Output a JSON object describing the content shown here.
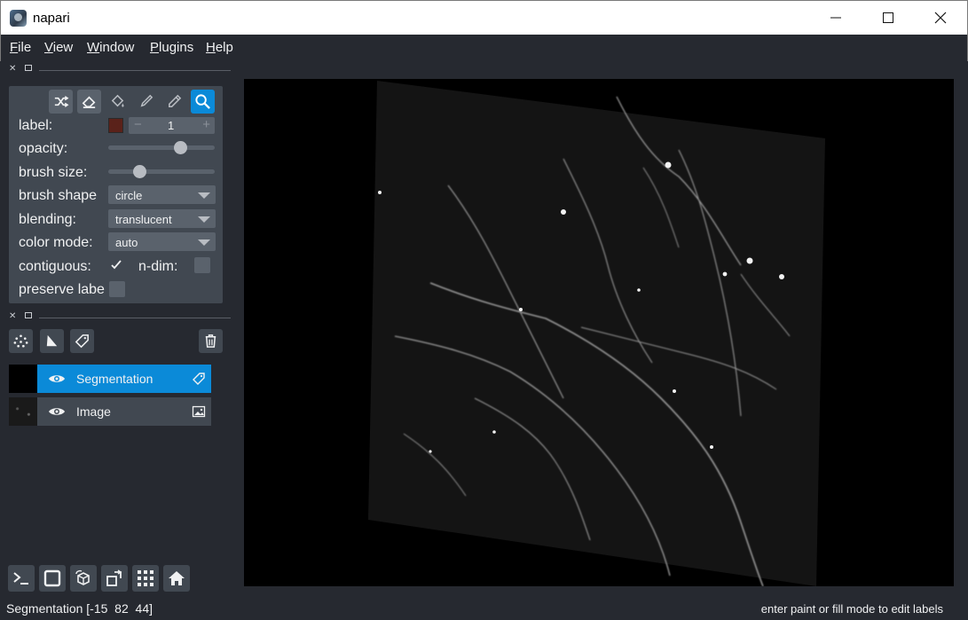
{
  "window": {
    "title": "napari",
    "icon": "napari-logo-icon"
  },
  "menu": [
    {
      "key": "F",
      "rest": "ile"
    },
    {
      "key": "V",
      "rest": "iew"
    },
    {
      "key": "W",
      "rest": "indow"
    },
    {
      "key": "P",
      "rest": "lugins"
    },
    {
      "key": "H",
      "rest": "elp"
    }
  ],
  "layer_controls": {
    "tools": [
      "shuffle-colors-icon",
      "eraser-icon",
      "fill-bucket-icon",
      "paintbrush-icon",
      "color-picker-icon",
      "pan-zoom-icon"
    ],
    "active_tool": "pan-zoom-icon",
    "label_caption": "label:",
    "label_value": "1",
    "label_color": "#5a221a",
    "opacity_caption": "opacity:",
    "opacity_value": 0.7,
    "brush_size_caption": "brush size:",
    "brush_size_fraction": 0.27,
    "brush_shape_caption": "brush shape",
    "brush_shape_value": "circle",
    "blending_caption": "blending:",
    "blending_value": "translucent",
    "color_mode_caption": "color mode:",
    "color_mode_value": "auto",
    "contiguous_caption": "contiguous:",
    "contiguous_checked": true,
    "ndim_caption": "n-dim:",
    "ndim_checked": false,
    "preserve_caption": "preserve labe",
    "preserve_checked": false
  },
  "layer_buttons": [
    "new-points-icon",
    "new-shapes-icon",
    "new-labels-icon",
    "delete-layer-icon"
  ],
  "layers": [
    {
      "name": "Segmentation",
      "visible": true,
      "selected": true,
      "type_icon": "labels-tag-icon"
    },
    {
      "name": "Image",
      "visible": true,
      "selected": false,
      "type_icon": "image-icon"
    }
  ],
  "console_buttons": [
    "console-icon",
    "ndisplay-square-icon",
    "roll-dims-icon",
    "transpose-icon",
    "grid-icon",
    "home-icon"
  ],
  "status": {
    "left": "Segmentation [-15  82  44]",
    "right": "enter paint or fill mode to edit labels"
  },
  "colors": {
    "accent": "#0b8ad8",
    "background": "#262930",
    "panel": "#414851",
    "button": "#5a626c"
  }
}
